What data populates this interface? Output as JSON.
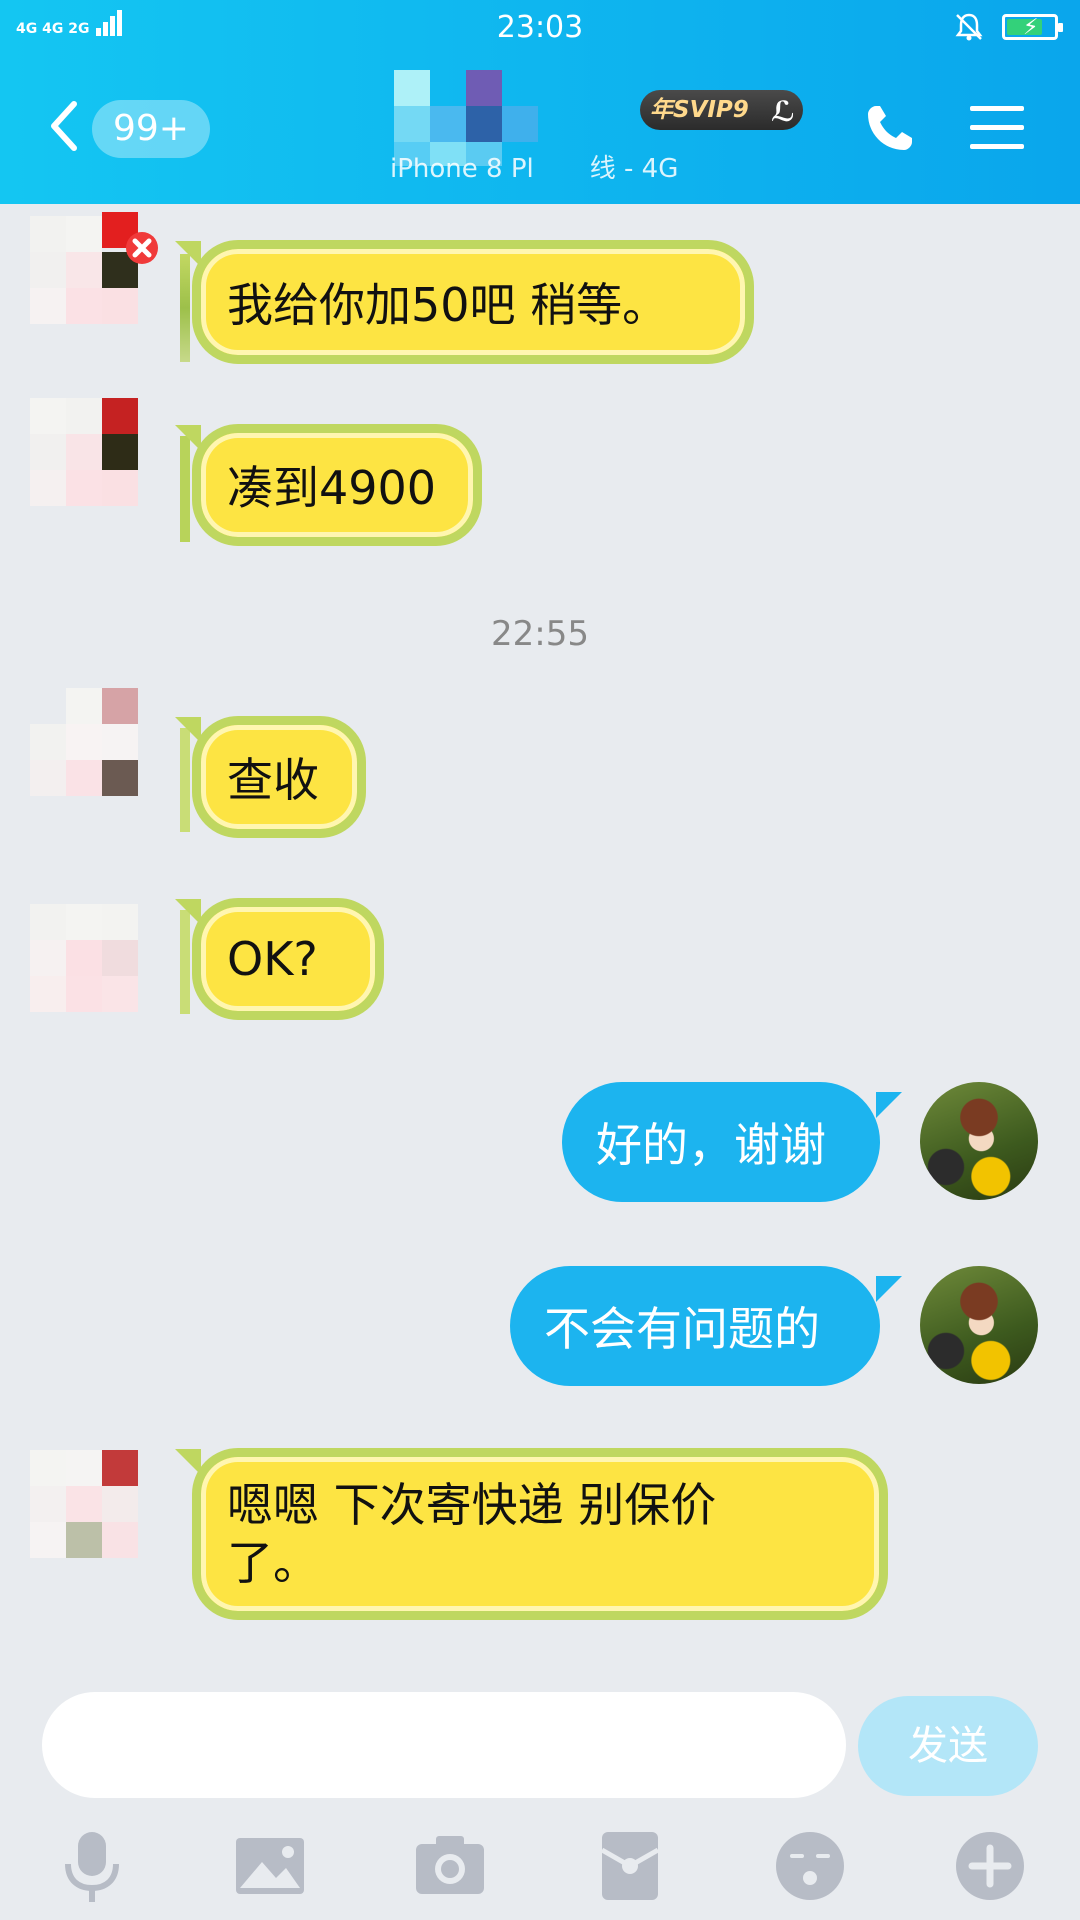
{
  "status_bar": {
    "signal_text": "4G 4G  2G",
    "time": "23:03",
    "battery_level": 0.7
  },
  "header": {
    "unread_badge": "99+",
    "vip_label": "年SVIP9",
    "vip_level_icon": "lightning-4",
    "subtitle_left": "iPhone 8 Pl",
    "subtitle_right": "线 - 4G"
  },
  "messages": [
    {
      "side": "left",
      "text": "我给你加50吧  稍等。"
    },
    {
      "side": "left",
      "text": "凑到4900"
    },
    {
      "type": "time",
      "text": "22:55"
    },
    {
      "side": "left",
      "text": "查收"
    },
    {
      "side": "left",
      "text": "OK?"
    },
    {
      "side": "right",
      "text": "好的，谢谢"
    },
    {
      "side": "right",
      "text": "不会有问题的"
    },
    {
      "side": "left",
      "text": "嗯嗯 下次寄快递 别保价了。"
    }
  ],
  "input": {
    "placeholder": "",
    "send_label": "发送"
  },
  "toolbar": [
    "microphone-icon",
    "image-icon",
    "camera-icon",
    "red-packet-icon",
    "emoji-icon",
    "plus-icon"
  ],
  "colors": {
    "header": "#0aa6ec",
    "bubble_yellow": "#fde443",
    "bubble_blue": "#1cb4ef"
  }
}
